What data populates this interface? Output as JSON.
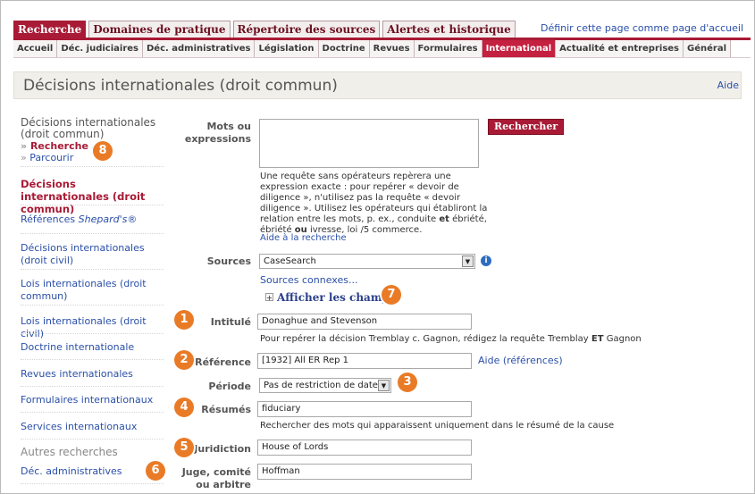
{
  "top_tabs": [
    "Recherche",
    "Domaines de pratique",
    "Répertoire des sources",
    "Alertes et historique"
  ],
  "set_home_link": "Définir cette page comme page d'accueil",
  "sub_tabs": [
    "Accueil",
    "Déc. judiciaires",
    "Déc. administratives",
    "Législation",
    "Doctrine",
    "Revues",
    "Formulaires",
    "International",
    "Actualité et entreprises",
    "Général"
  ],
  "page_title": "Décisions internationales (droit commun)",
  "help_link": "Aide",
  "leftnav": {
    "section_title": "Décisions internationales (droit commun)",
    "sub_search": "Recherche",
    "sub_browse": "Parcourir",
    "current": "Décisions internationales (droit commun)",
    "shepards_prefix": "Références ",
    "shepards_name": "Shepard's",
    "shepards_mark": "®",
    "items": [
      "Décisions internationales (droit civil)",
      "Lois internationales (droit commun)",
      "Lois internationales (droit civil)",
      "Doctrine internationale",
      "Revues internationales",
      "Formulaires internationaux",
      "Services internationaux"
    ],
    "other_title": "Autres recherches",
    "other_item": "Déc. administratives"
  },
  "form": {
    "words_label": "Mots ou expressions",
    "search_button": "Rechercher",
    "words_value": "",
    "hint_text": "Une requête sans opérateurs repèrera une expression exacte : pour repérer « devoir de diligence », n'utilisez pas la requête « devoir diligence ». Utilisez les opérateurs qui établiront la relation entre les mots, p. ex., conduite ",
    "hint_et": "et",
    "hint_mid": " ébriété, ébriété ",
    "hint_ou": "ou",
    "hint_end": " ivresse, loi /5 commerce.",
    "help_search": "Aide à la recherche",
    "sources_label": "Sources",
    "sources_value": "CaseSearch",
    "related_sources": "Sources connexes...",
    "show_fields": "Afficher les champs",
    "title_label": "Intitulé",
    "title_value": "Donaghue and Stevenson",
    "title_hint_pre": "Pour repérer la décision Tremblay c. Gagnon, rédigez la requête Tremblay ",
    "title_hint_et": "ET",
    "title_hint_post": " Gagnon",
    "ref_label": "Référence",
    "ref_value": "[1932] All ER Rep 1",
    "ref_help": "Aide (références)",
    "period_label": "Période",
    "period_value": "Pas de restriction de date",
    "summary_label": "Résumés",
    "summary_value": "fiduciary",
    "summary_hint": "Rechercher des mots qui apparaissent uniquement dans le résumé de la cause",
    "juris_label": "Juridiction",
    "juris_value": "House of Lords",
    "judge_label": "Juge, comité ou arbitre",
    "judge_value": "Hoffman"
  },
  "badges": [
    "1",
    "2",
    "3",
    "4",
    "5",
    "6",
    "7",
    "8"
  ],
  "colors": {
    "brand": "#a81a35",
    "link": "#2a4fa8",
    "badge": "#e97b27"
  }
}
